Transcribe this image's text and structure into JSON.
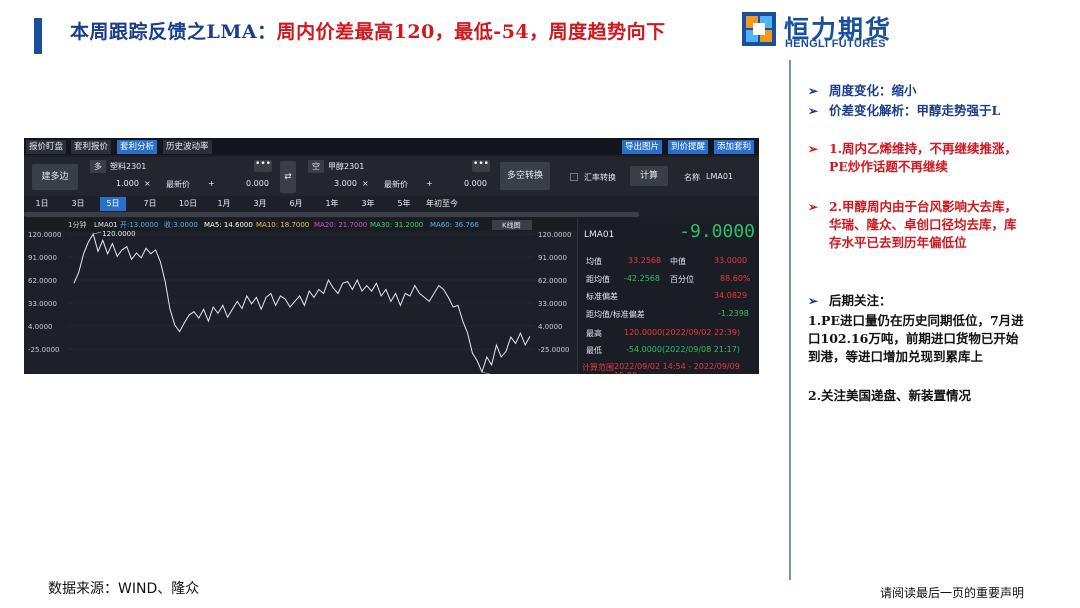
{
  "slide": {
    "title_part1": "本周跟踪反馈之LMA：",
    "title_part2": "周内价差最高120，最低-54，周度趋势向下",
    "logo_cn": "恒力期货",
    "logo_en": "HENGLI FUTURES",
    "source": "数据来源：WIND、隆众",
    "disclaimer": "请阅读最后一页的重要声明"
  },
  "app": {
    "tabs": [
      "报价盯盘",
      "套利报价",
      "套利分析",
      "历史波动率"
    ],
    "active_tab": "套利分析",
    "toolbar_buttons": [
      "导出图片",
      "到价提醒",
      "添加套利"
    ],
    "build_button": "建多边",
    "leg1": {
      "side": "多",
      "contract": "塑料2301",
      "qty": "1.000",
      "x": "×",
      "price_type": "最新价",
      "plus": "+",
      "offset": "0.000"
    },
    "swap_button": "⇄",
    "leg2": {
      "side": "空",
      "contract": "甲醇2301",
      "qty": "3.000",
      "x": "×",
      "price_type": "最新价",
      "plus": "+",
      "offset": "0.000"
    },
    "dots": "•••",
    "longshort_button": "多空转换",
    "fx_checkbox_label": "汇率转换",
    "calc_button": "计算",
    "name_label": "名称",
    "name_value": "LMA01",
    "periods": [
      "1日",
      "3日",
      "5日",
      "7日",
      "10日",
      "1月",
      "3月",
      "6月",
      "1年",
      "3年",
      "5年",
      "年初至今"
    ],
    "active_period": "5日",
    "chart_legend": {
      "interval": "1分钟",
      "code": "LMA01",
      "open": "开:13.0000",
      "close": "收:3.0000",
      "ma5": "MA5: 14.6000",
      "ma10": "MA10: 18.7000",
      "ma20": "MA20: 21.7000",
      "ma30": "MA30: 31.2000",
      "ma60": "MA60: 36.766",
      "kline_button": "K线图"
    },
    "colors": {
      "accent": "#2a6fc9",
      "up": "#e8383d",
      "down": "#2bbf6a",
      "ma5": "#ffffff",
      "ma10": "#e8c547",
      "ma20": "#d14fd6",
      "ma30": "#3ed66b",
      "ma60": "#4fb3f5"
    },
    "stats": {
      "code": "LMA01",
      "last": "-9.0000",
      "rows": [
        {
          "k1": "均值",
          "v1": "33.2568",
          "k2": "中值",
          "v2": "33.0000"
        },
        {
          "k1": "距均值",
          "v1": "-42.2568",
          "k2": "百分位",
          "v2": "88.60%"
        },
        {
          "k1": "标准偏差",
          "v1": "34.0829"
        },
        {
          "k1": "距均值/标准偏差",
          "v1": "-1.2398"
        },
        {
          "k1": "最高",
          "v1": "120.0000(2022/09/02 22:39)"
        },
        {
          "k1": "最低",
          "v1": "-54.0000(2022/09/08 21:17)"
        },
        {
          "k1": "计算范围",
          "v1": "2022/09/02 14:54 - 2022/09/09 15:00"
        }
      ]
    }
  },
  "chart_data": {
    "type": "line",
    "series": [
      {
        "name": "LMA01",
        "values": [
          58,
          72,
          95,
          110,
          120,
          98,
          112,
          95,
          108,
          92,
          100,
          104,
          88,
          96,
          90,
          102,
          95,
          100,
          85,
          60,
          25,
          5,
          -3,
          8,
          18,
          22,
          14,
          25,
          10,
          28,
          20,
          30,
          15,
          25,
          35,
          26,
          42,
          32,
          40,
          25,
          40,
          45,
          30,
          42,
          38,
          28,
          35,
          42,
          30,
          48,
          40,
          50,
          45,
          62,
          52,
          45,
          58,
          60,
          50,
          62,
          48,
          55,
          48,
          58,
          42,
          50,
          35,
          45,
          30,
          45,
          42,
          55,
          45,
          40,
          35,
          45,
          55,
          50,
          40,
          28,
          30,
          10,
          -5,
          -30,
          -40,
          -54,
          -35,
          -45,
          -20,
          -35,
          -28,
          -10,
          -18,
          -5,
          -20,
          -9
        ]
      }
    ],
    "y_ticks": [
      "120.0000",
      "91.0000",
      "62.0000",
      "33.0000",
      "4.0000",
      "-25.0000"
    ],
    "ylim": [
      -54,
      120
    ],
    "annotations": [
      {
        "label": "120.0000",
        "value": 120
      },
      {
        "label": "-54.0000",
        "value": -54
      }
    ]
  },
  "notes": {
    "items": [
      {
        "color": "blue",
        "text": "周度变化：缩小"
      },
      {
        "color": "blue",
        "text": "价差变化解析：甲醇走势强于L"
      },
      {
        "color": "red",
        "text": "1.周内乙烯维持，不再继续推涨，PE炒作话题不再继续"
      },
      {
        "color": "red",
        "text": "2.甲醇周内由于台风影响大去库，华瑞、隆众、卓创口径均去库，库存水平已去到历年偏低位"
      },
      {
        "color": "black",
        "text": "后期关注："
      }
    ],
    "outlook": [
      "1.PE进口量仍在历史同期低位，7月进口102.16万吨，前期进口货物已开始到港，等进口增加兑现到累库上",
      "2.关注美国递盘、新装置情况"
    ],
    "bullet": "➢"
  }
}
